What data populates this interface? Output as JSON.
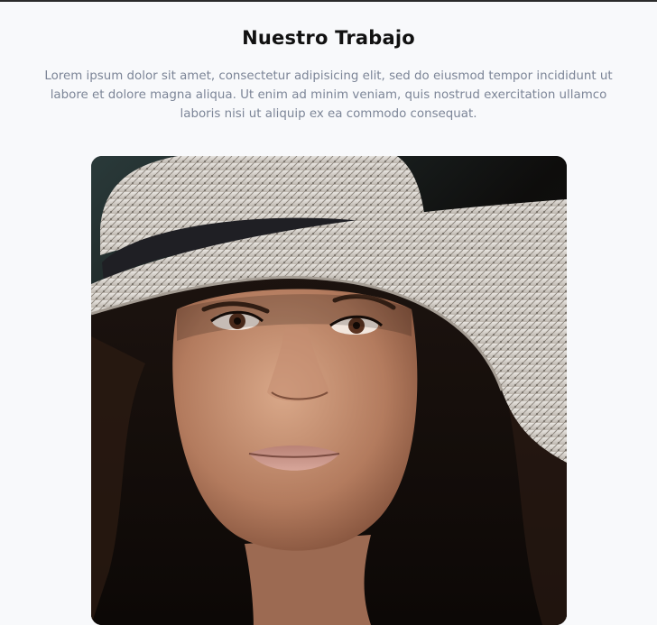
{
  "section": {
    "title": "Nuestro Trabajo",
    "description": "Lorem ipsum dolor sit amet, consectetur adipisicing elit, sed do eiusmod tempor incididunt ut labore et dolore magna aliqua. Ut enim ad minim veniam, quis nostrud exercitation ullamco laboris nisi ut aliquip ex ea commodo consequat."
  },
  "colors": {
    "background": "#f8f9fb",
    "title": "#111111",
    "description": "#7c8597",
    "top_border": "#2b2b2b"
  },
  "image": {
    "subject": "portrait of a woman wearing a woven straw sun hat with a black band"
  }
}
